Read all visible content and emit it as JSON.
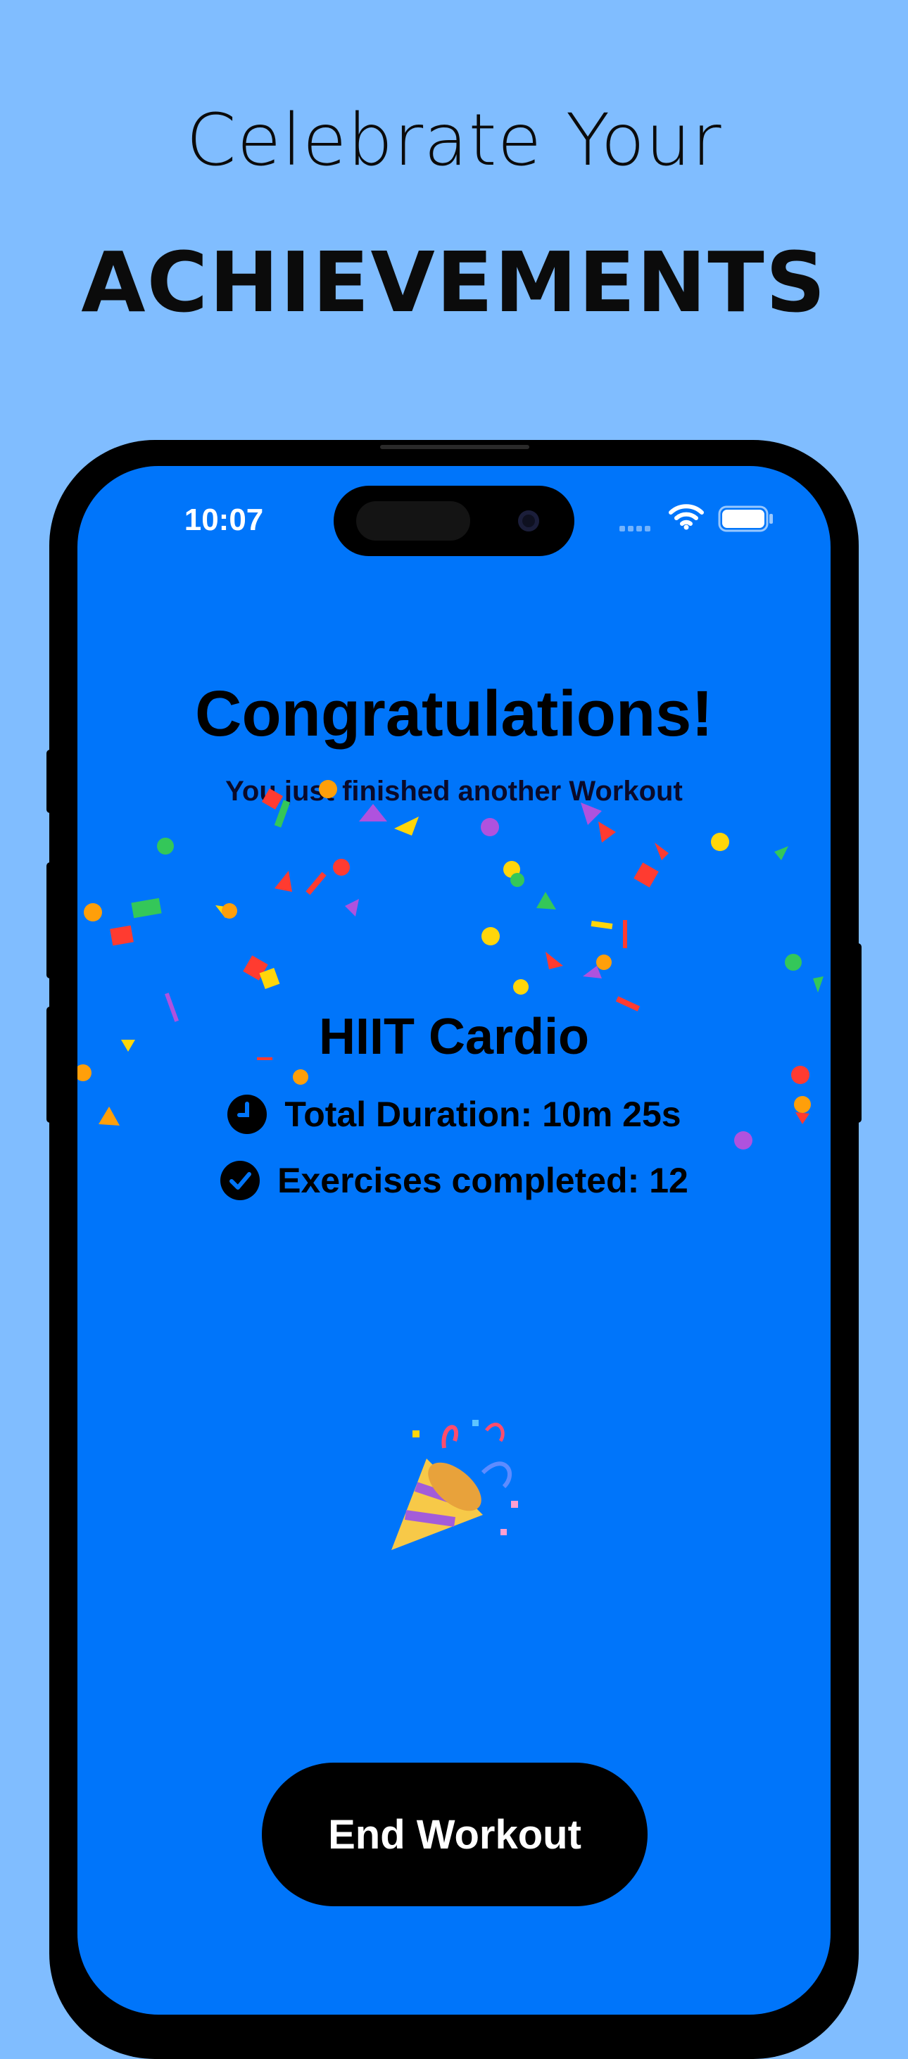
{
  "marketing": {
    "line1": "Celebrate Your",
    "line2": "ACHIEVEMENTS"
  },
  "status_bar": {
    "time": "10:07"
  },
  "summary": {
    "title": "Congratulations!",
    "subtitle": "You just finished another Workout",
    "workout_name": "HIIT Cardio",
    "total_duration_label": "Total Duration:",
    "total_duration_value": "10m 25s",
    "exercises_label": "Exercises completed:",
    "exercises_value": "12"
  },
  "actions": {
    "end_workout_label": "End Workout"
  },
  "icons": {
    "duration": "clock-icon",
    "exercises": "checkmark-circle-icon",
    "celebration": "party-popper-icon"
  },
  "colors": {
    "background": "#80BDFF",
    "screen": "#0075FA",
    "button": "#000000"
  }
}
